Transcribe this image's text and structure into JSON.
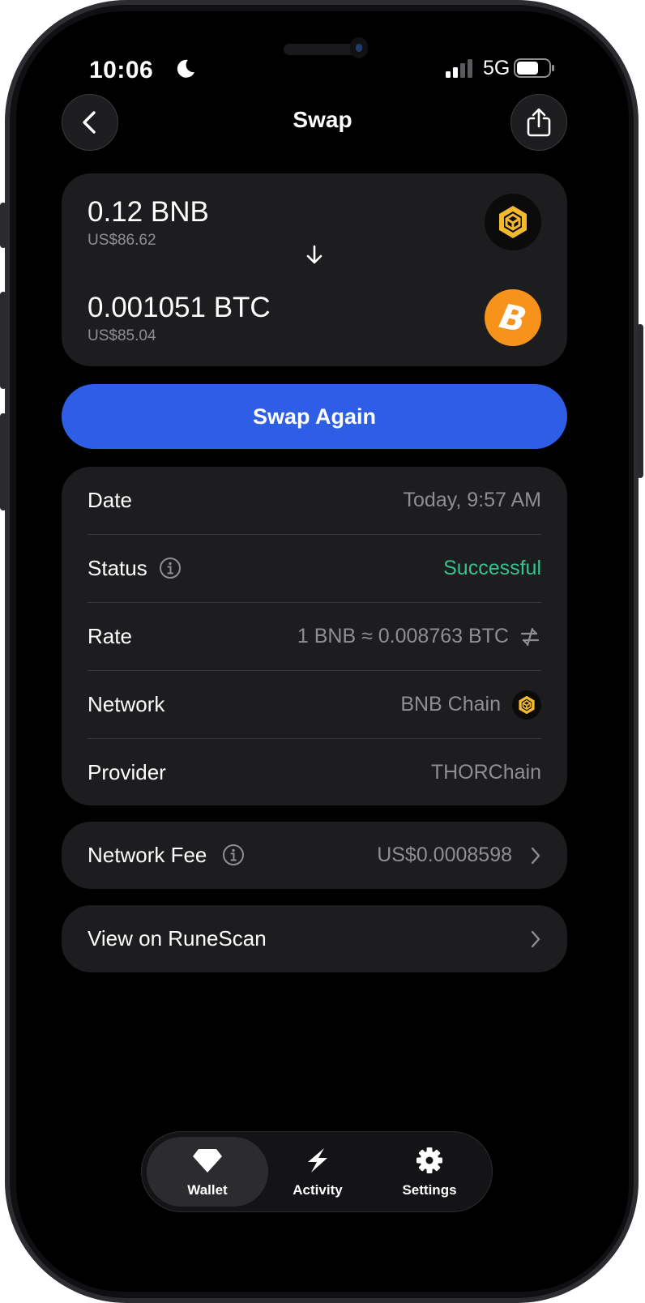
{
  "status_bar": {
    "time": "10:06",
    "network": "5G"
  },
  "header": {
    "title": "Swap"
  },
  "swap_card": {
    "from": {
      "amount": "0.12 BNB",
      "fiat": "US$86.62"
    },
    "to": {
      "amount": "0.001051 BTC",
      "fiat": "US$85.04"
    }
  },
  "actions": {
    "swap_again_label": "Swap Again"
  },
  "details": {
    "date": {
      "label": "Date",
      "value": "Today, 9:57 AM"
    },
    "status": {
      "label": "Status",
      "value": "Successful"
    },
    "rate": {
      "label": "Rate",
      "value": "1 BNB ≈ 0.008763 BTC"
    },
    "network": {
      "label": "Network",
      "value": "BNB Chain"
    },
    "provider": {
      "label": "Provider",
      "value": "THORChain"
    }
  },
  "fee": {
    "label": "Network Fee",
    "value": "US$0.0008598"
  },
  "explorer": {
    "label": "View on RuneScan"
  },
  "tabbar": {
    "items": [
      {
        "label": "Wallet",
        "icon": "diamond-icon",
        "active": true
      },
      {
        "label": "Activity",
        "icon": "lightning-icon",
        "active": false
      },
      {
        "label": "Settings",
        "icon": "gear-icon",
        "active": false
      }
    ]
  },
  "colors": {
    "accent": "#2f5ee6",
    "success": "#34c38f",
    "bnb": "#f3ba2f",
    "btc": "#f7931a",
    "card": "#1d1d1f"
  }
}
